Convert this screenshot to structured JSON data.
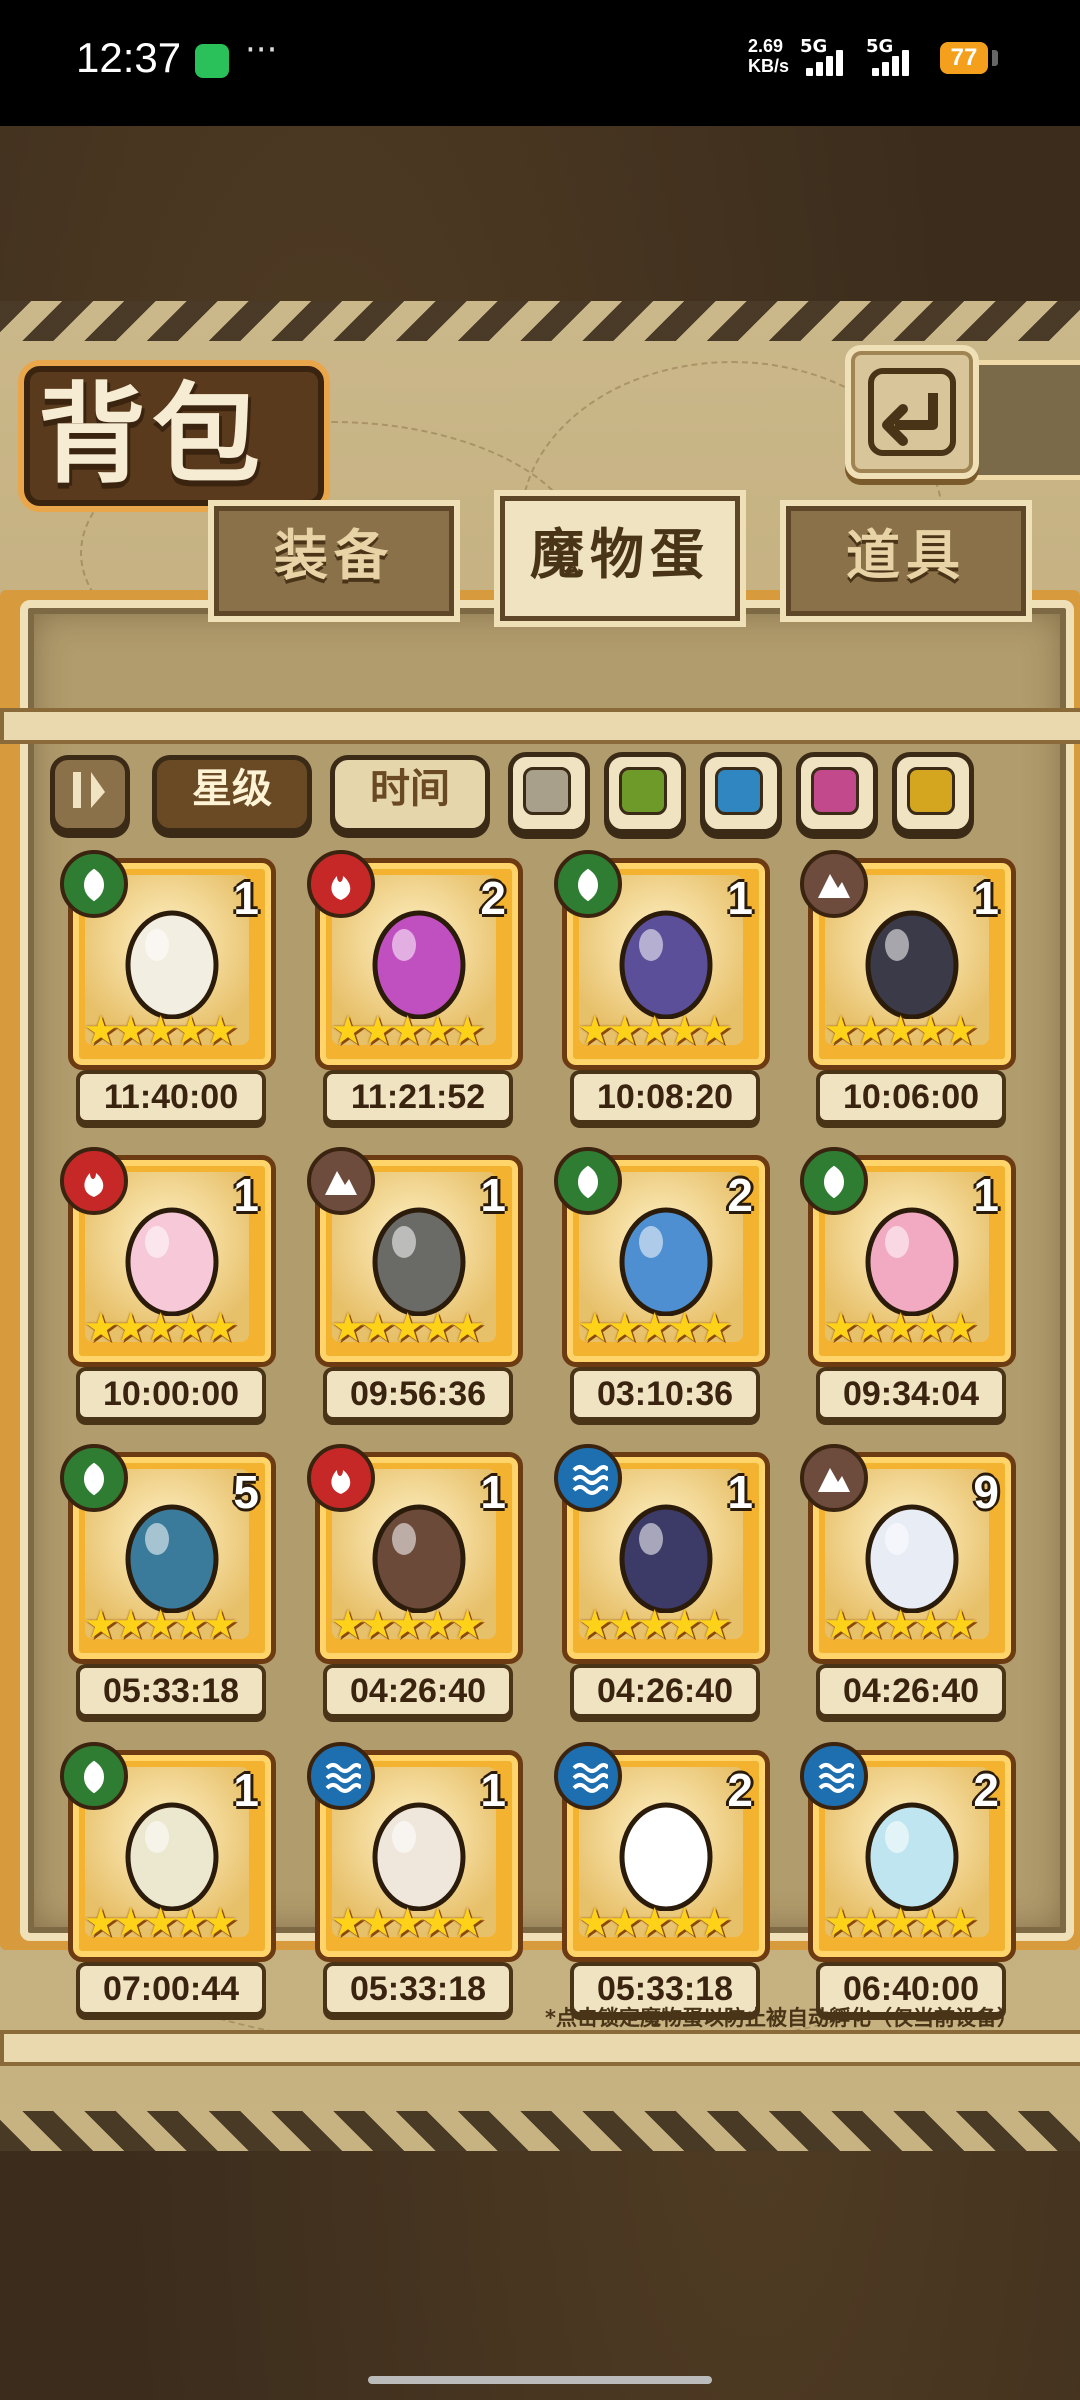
{
  "status_bar": {
    "time": "12:37",
    "net_speed_value": "2.69",
    "net_speed_unit": "KB/s",
    "sim1": "5G",
    "sim2": "5G",
    "battery": "77"
  },
  "header": {
    "title": "背包"
  },
  "tabs": [
    {
      "label": "装备",
      "active": false
    },
    {
      "label": "魔物蛋",
      "active": true
    },
    {
      "label": "道具",
      "active": false
    }
  ],
  "filters": {
    "sort_star": "星级",
    "sort_time": "时间",
    "color_swatches": [
      "#a8a08a",
      "#6e9a2a",
      "#2f86c0",
      "#c24a8c",
      "#d4a620"
    ]
  },
  "element_colors": {
    "grass": "#2e7d32",
    "fire": "#c62828",
    "earth": "#6d4c3d",
    "water": "#1e6fb0"
  },
  "eggs": [
    {
      "element": "grass",
      "count": "1",
      "stars": 5,
      "timer": "11:40:00",
      "egg_color": "#f3eee2"
    },
    {
      "element": "fire",
      "count": "2",
      "stars": 5,
      "timer": "11:21:52",
      "egg_color": "#c04fc0"
    },
    {
      "element": "grass",
      "count": "1",
      "stars": 5,
      "timer": "10:08:20",
      "egg_color": "#5b4f9a"
    },
    {
      "element": "earth",
      "count": "1",
      "stars": 5,
      "timer": "10:06:00",
      "egg_color": "#3a3a48"
    },
    {
      "element": "fire",
      "count": "1",
      "stars": 5,
      "timer": "10:00:00",
      "egg_color": "#f6c8d8"
    },
    {
      "element": "earth",
      "count": "1",
      "stars": 5,
      "timer": "09:56:36",
      "egg_color": "#6a6a66"
    },
    {
      "element": "grass",
      "count": "2",
      "stars": 5,
      "timer": "03:10:36",
      "egg_color": "#4d8fd0"
    },
    {
      "element": "grass",
      "count": "1",
      "stars": 5,
      "timer": "09:34:04",
      "egg_color": "#f2a9c2"
    },
    {
      "element": "grass",
      "count": "5",
      "stars": 5,
      "timer": "05:33:18",
      "egg_color": "#3a7a9a"
    },
    {
      "element": "fire",
      "count": "1",
      "stars": 5,
      "timer": "04:26:40",
      "egg_color": "#6b4a3a"
    },
    {
      "element": "water",
      "count": "1",
      "stars": 5,
      "timer": "04:26:40",
      "egg_color": "#3c3a66"
    },
    {
      "element": "earth",
      "count": "9",
      "stars": 5,
      "timer": "04:26:40",
      "egg_color": "#e8ecf5"
    },
    {
      "element": "grass",
      "count": "1",
      "stars": 5,
      "timer": "07:00:44",
      "egg_color": "#ece7cf"
    },
    {
      "element": "water",
      "count": "1",
      "stars": 5,
      "timer": "05:33:18",
      "egg_color": "#efe6dc"
    },
    {
      "element": "water",
      "count": "2",
      "stars": 5,
      "timer": "05:33:18",
      "egg_color": "#ffffff"
    },
    {
      "element": "water",
      "count": "2",
      "stars": 5,
      "timer": "06:40:00",
      "egg_color": "#bfe6f0"
    }
  ],
  "footnote": "*点击锁定魔物蛋以防止被自动孵化（仅当前设备）"
}
